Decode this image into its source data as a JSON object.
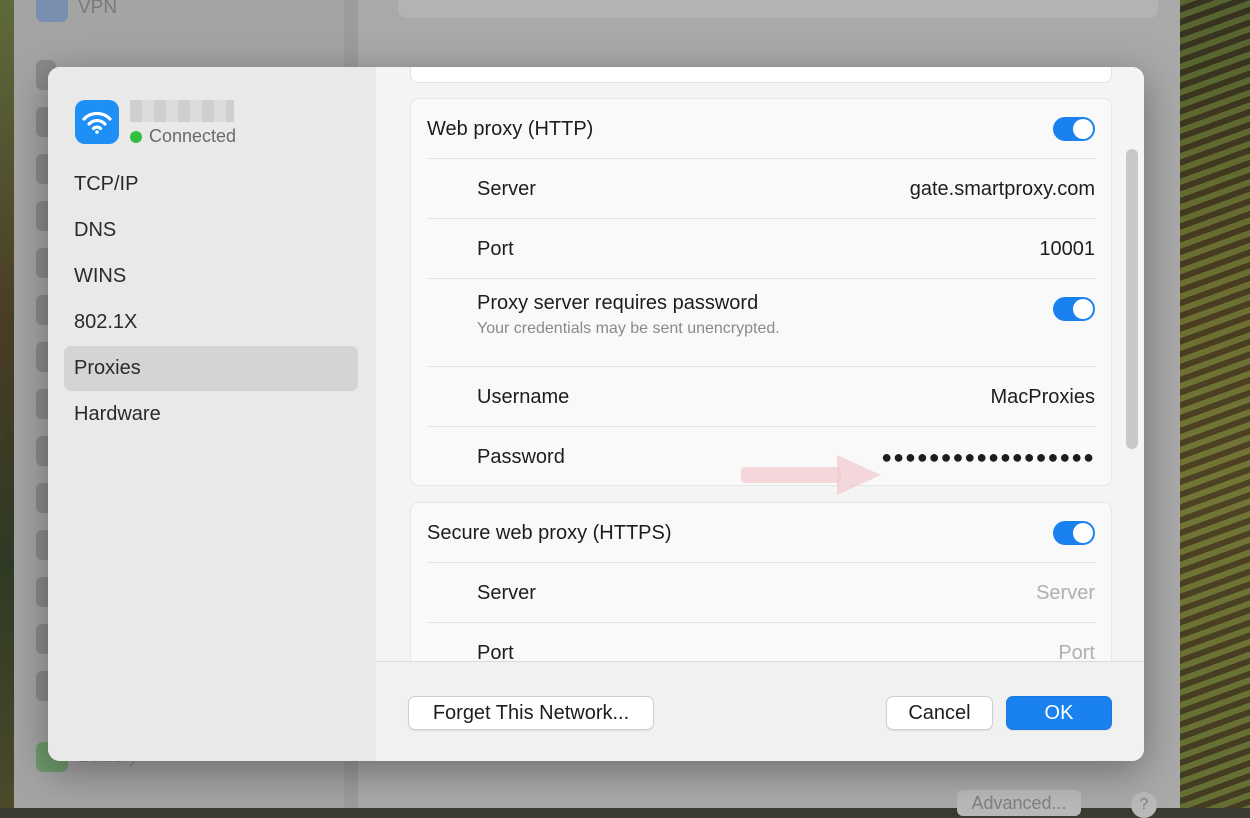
{
  "background": {
    "sidebar_top_item": "VPN",
    "sidebar_bottom_item": "Battery",
    "advanced_button": "Advanced...",
    "help_button": "?"
  },
  "network": {
    "status": "Connected"
  },
  "sidebar": {
    "items": [
      {
        "label": "TCP/IP"
      },
      {
        "label": "DNS"
      },
      {
        "label": "WINS"
      },
      {
        "label": "802.1X"
      },
      {
        "label": "Proxies",
        "selected": true
      },
      {
        "label": "Hardware"
      }
    ]
  },
  "http_proxy": {
    "title": "Web proxy (HTTP)",
    "enabled": true,
    "server_label": "Server",
    "server_value": "gate.smartproxy.com",
    "port_label": "Port",
    "port_value": "10001",
    "requires_password_label": "Proxy server requires password",
    "requires_password_hint": "Your credentials may be sent unencrypted.",
    "requires_password_enabled": true,
    "username_label": "Username",
    "username_value": "MacProxies",
    "password_label": "Password",
    "password_value": "●●●●●●●●●●●●●●●●●●"
  },
  "https_proxy": {
    "title": "Secure web proxy (HTTPS)",
    "enabled": true,
    "server_label": "Server",
    "server_placeholder": "Server",
    "port_label": "Port",
    "port_placeholder": "Port"
  },
  "footer": {
    "forget_label": "Forget This Network...",
    "cancel_label": "Cancel",
    "ok_label": "OK"
  },
  "colors": {
    "accent": "#1a82f0",
    "connected_dot": "#33c03f"
  }
}
